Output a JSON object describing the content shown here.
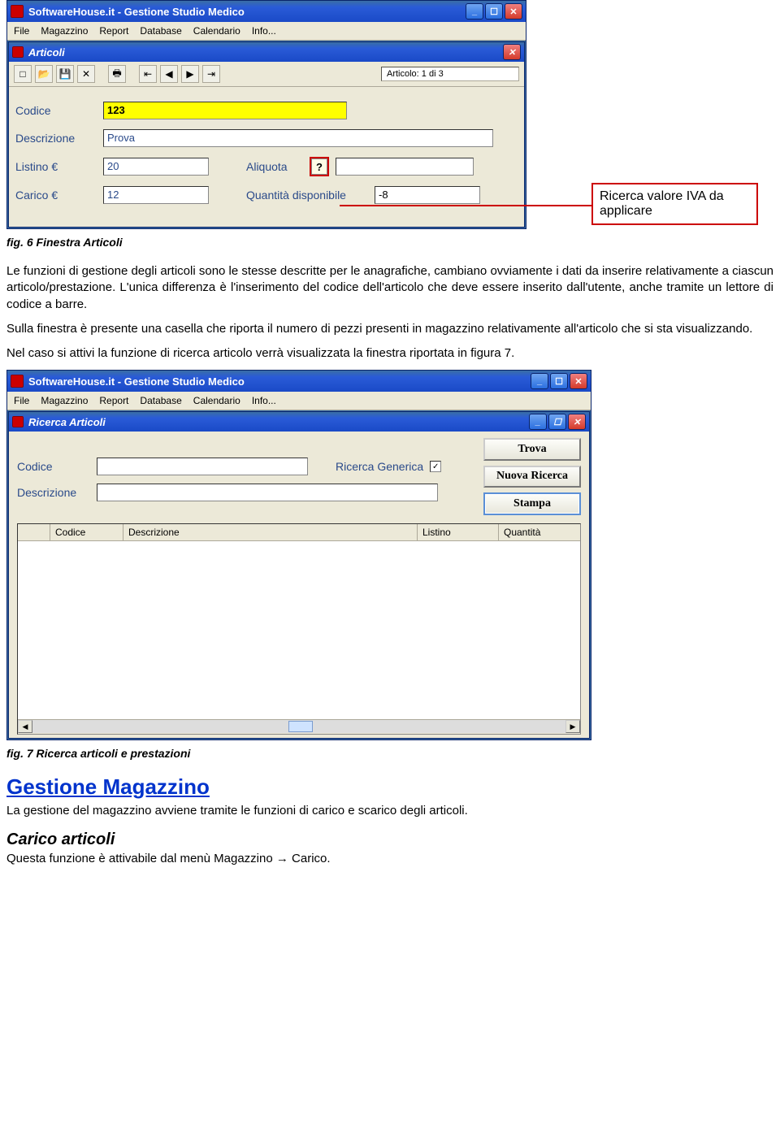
{
  "callout": {
    "text": "Ricerca valore IVA da applicare"
  },
  "fig6": {
    "appTitle": "SoftwareHouse.it - Gestione Studio Medico",
    "menus": [
      "File",
      "Magazzino",
      "Report",
      "Database",
      "Calendario",
      "Info..."
    ],
    "innerTitle": "Articoli",
    "status": "Articolo: 1 di 3",
    "labels": {
      "codice": "Codice",
      "descrizione": "Descrizione",
      "listino": "Listino €",
      "aliquota": "Aliquota",
      "carico": "Carico €",
      "quantita": "Quantità disponibile"
    },
    "values": {
      "codice": "123",
      "descrizione": "Prova",
      "listino": "20",
      "aliquota": "",
      "carico": "12",
      "quantita": "-8"
    },
    "caption": "fig. 6 Finestra Articoli"
  },
  "para1": "Le funzioni di gestione degli articoli sono le stesse descritte per le anagrafiche, cambiano ovviamente i dati da inserire relativamente a ciascun articolo/prestazione. L'unica differenza è l'inserimento del codice dell'articolo che deve essere inserito dall'utente, anche tramite un lettore di codice a barre.",
  "para2": "Sulla finestra è presente una casella che riporta il numero di pezzi presenti in magazzino relativamente all'articolo che si sta visualizzando.",
  "para3": "Nel caso si attivi la funzione di ricerca articolo verrà visualizzata la finestra riportata in figura 7.",
  "fig7": {
    "appTitle": "SoftwareHouse.it - Gestione Studio Medico",
    "menus": [
      "File",
      "Magazzino",
      "Report",
      "Database",
      "Calendario",
      "Info..."
    ],
    "innerTitle": "Ricerca Articoli",
    "labels": {
      "codice": "Codice",
      "descrizione": "Descrizione",
      "ricercaGenerica": "Ricerca Generica"
    },
    "buttons": {
      "trova": "Trova",
      "nuova": "Nuova Ricerca",
      "stampa": "Stampa"
    },
    "cols": {
      "codice": "Codice",
      "descrizione": "Descrizione",
      "listino": "Listino",
      "quantita": "Quantità"
    },
    "caption": "fig. 7 Ricerca articoli e prestazioni"
  },
  "sectionTitle": "Gestione Magazzino",
  "sectionText": "La gestione del magazzino avviene tramite le funzioni di carico e scarico degli articoli.",
  "subTitle": "Carico articoli",
  "subText": "Questa funzione è attivabile dal menù Magazzino → Carico."
}
